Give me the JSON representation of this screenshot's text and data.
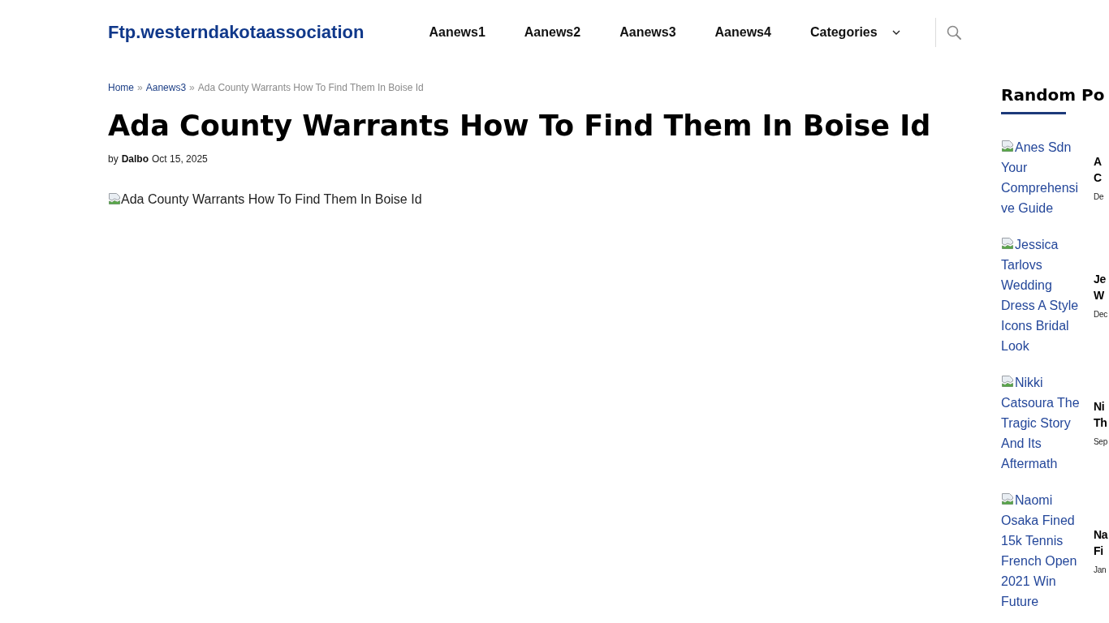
{
  "header": {
    "logo": "Ftp.westerndakotaassociation",
    "nav": [
      {
        "label": "Aanews1",
        "kind": "link"
      },
      {
        "label": "Aanews2",
        "kind": "link"
      },
      {
        "label": "Aanews3",
        "kind": "link"
      },
      {
        "label": "Aanews4",
        "kind": "link"
      },
      {
        "label": "Categories",
        "kind": "dropdown"
      }
    ]
  },
  "breadcrumb": [
    {
      "text": "Home",
      "kind": "link"
    },
    {
      "text": "»",
      "kind": "separator"
    },
    {
      "text": "Aanews3",
      "kind": "link"
    },
    {
      "text": "»",
      "kind": "separator"
    },
    {
      "text": "Ada County Warrants How To Find Them In Boise Id",
      "kind": "current"
    }
  ],
  "article": {
    "title": "Ada County Warrants How To Find Them In Boise Id",
    "byline": {
      "prefix": "by",
      "author": "Dalbo",
      "date": "Oct 15, 2025"
    },
    "image_alt": "Ada County Warrants How To Find Them In Boise Id"
  },
  "sidebar": {
    "heading": "Random Po",
    "posts": [
      {
        "image_alt": "Anes Sdn Your Comprehensive Guide",
        "title_lines": [
          "A",
          "C"
        ],
        "date": "De"
      },
      {
        "image_alt": "Jessica Tarlovs Wedding Dress A Style Icons Bridal Look",
        "title_lines": [
          "Je",
          "W"
        ],
        "date": "Dec"
      },
      {
        "image_alt": "Nikki Catsoura The Tragic Story And Its Aftermath",
        "title_lines": [
          "Ni",
          "Th"
        ],
        "date": "Sep"
      },
      {
        "image_alt": "Naomi Osaka Fined 15k Tennis French Open 2021 Win Future",
        "title_lines": [
          "Na",
          "Fi"
        ],
        "date": "Jan"
      }
    ]
  }
}
